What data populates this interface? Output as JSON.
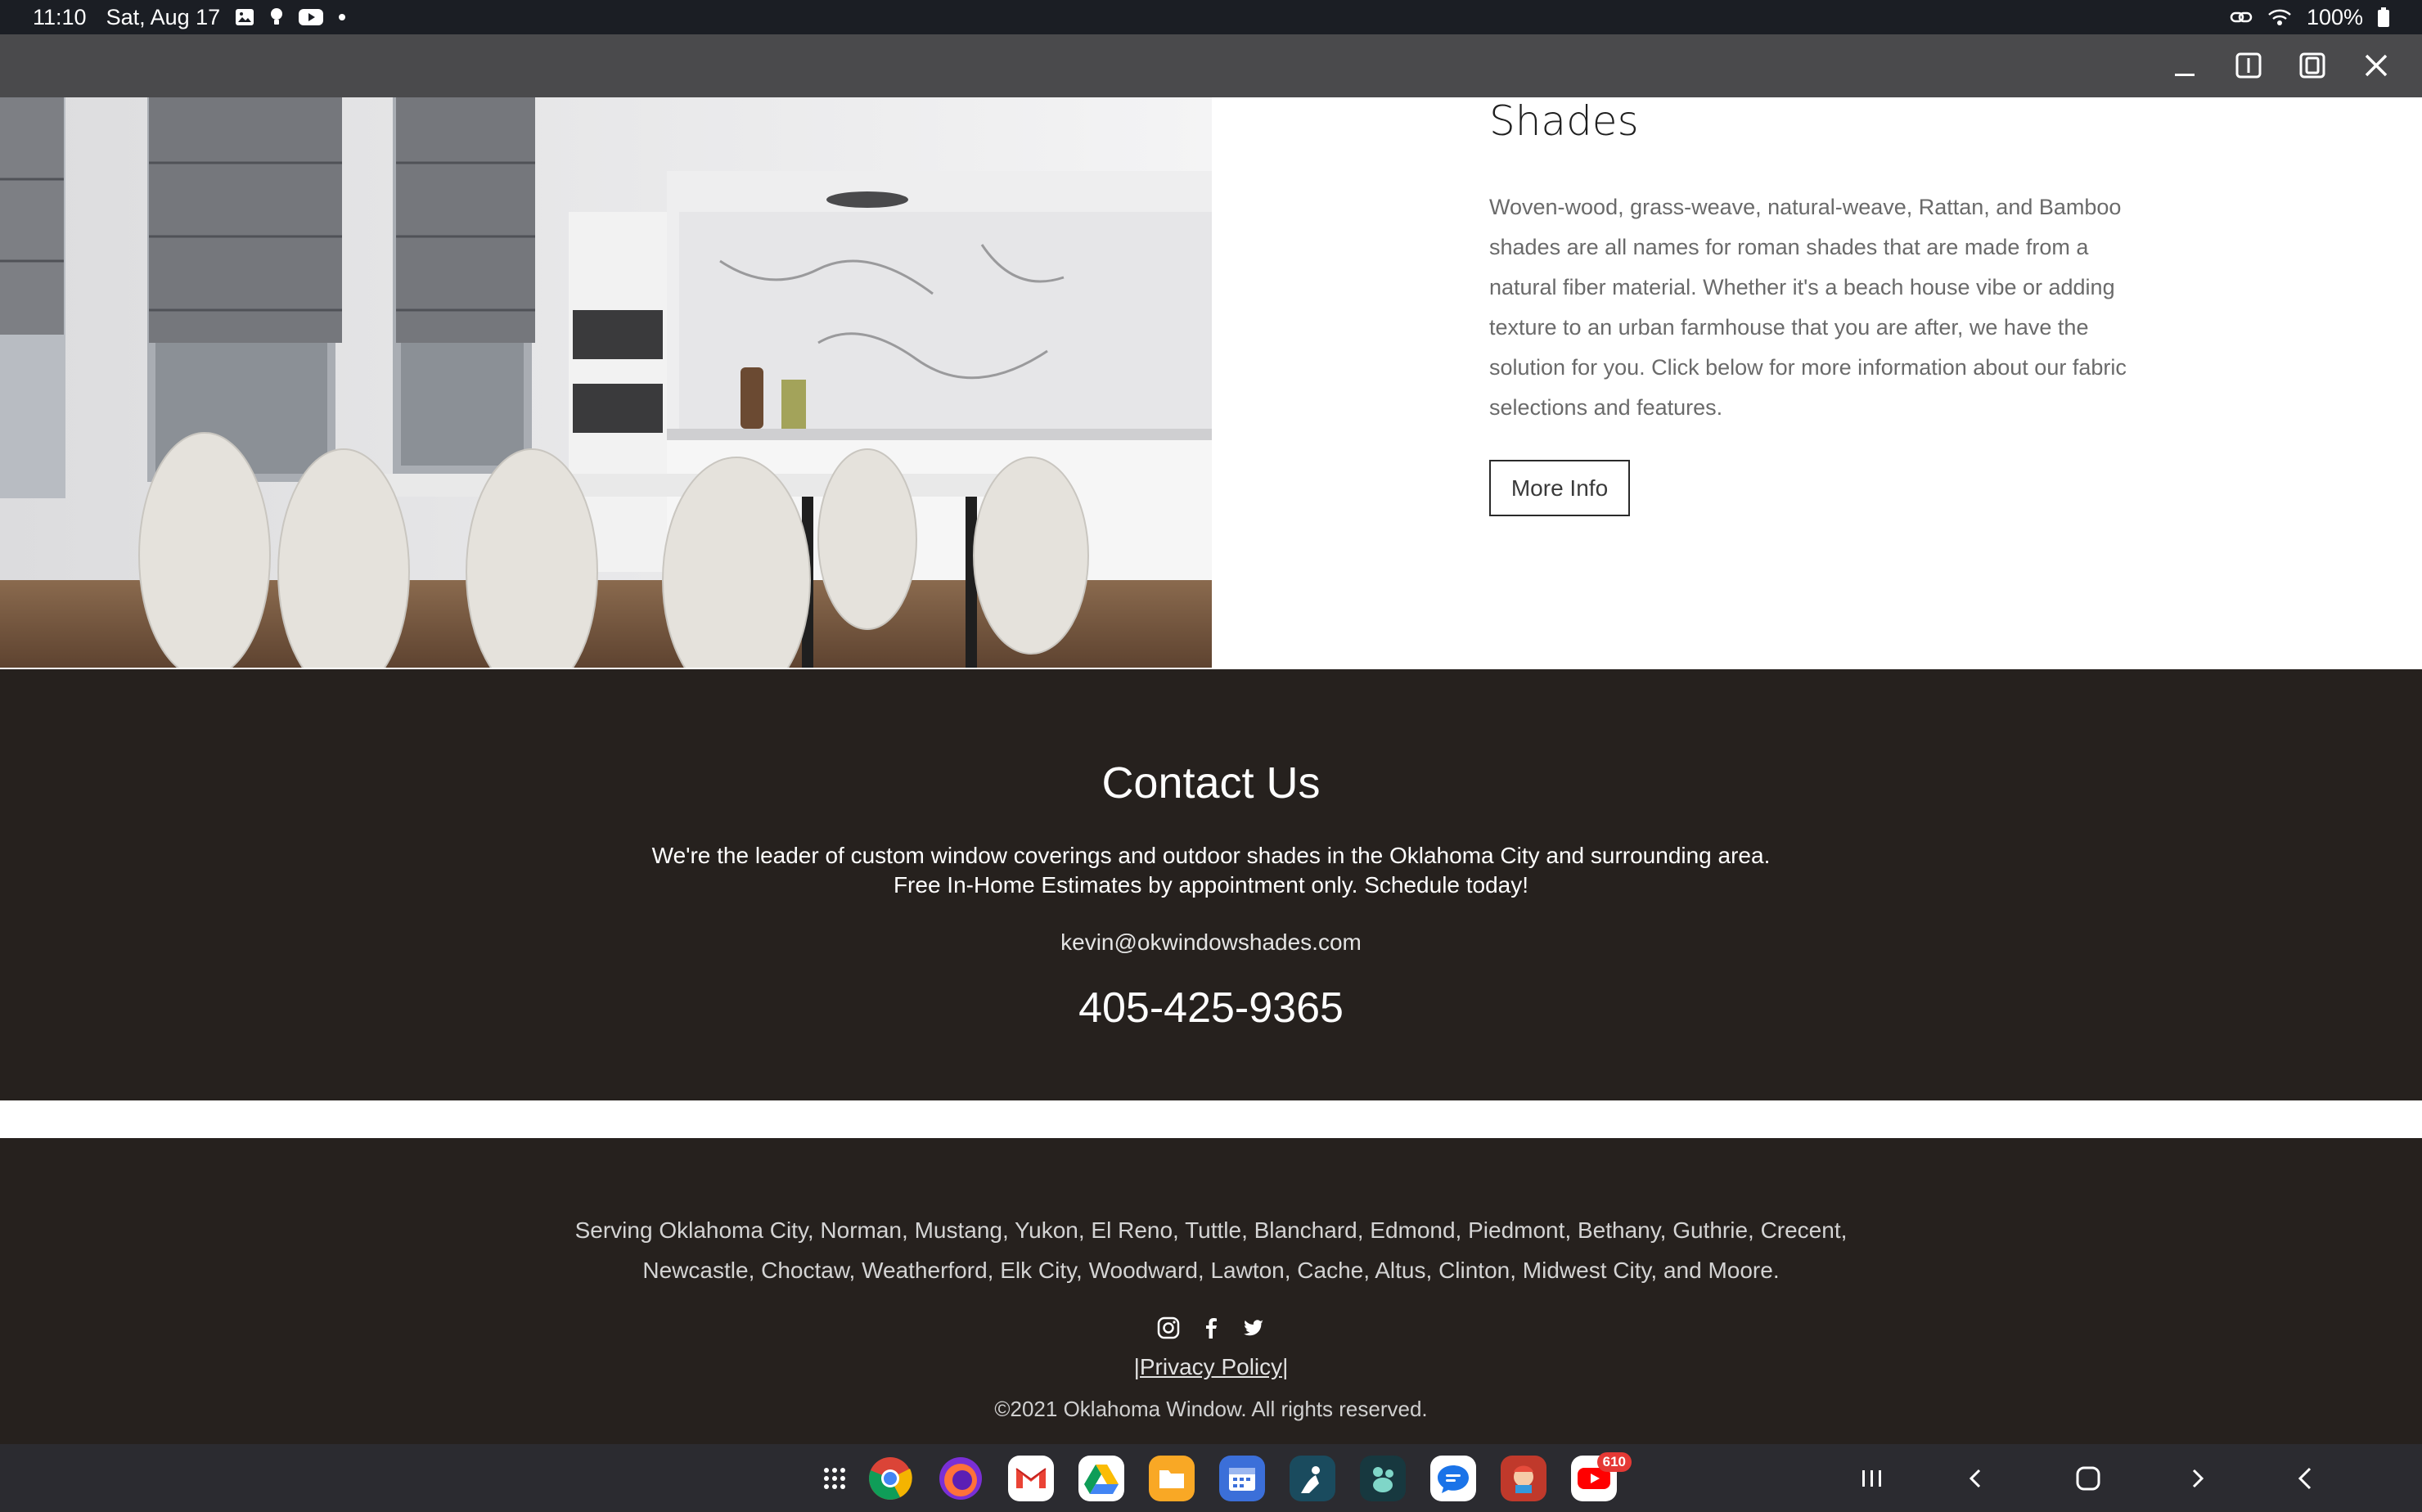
{
  "status_bar": {
    "time": "11:10",
    "date": "Sat, Aug 17",
    "notification_icons": [
      "gallery-icon",
      "tips-icon",
      "youtube-icon",
      "dot-icon"
    ],
    "battery": "100%",
    "system_icons": [
      "link-icon",
      "wifi-icon",
      "battery-icon"
    ]
  },
  "window_controls": [
    "minimize-icon",
    "split-view-icon",
    "popup-view-icon",
    "close-icon"
  ],
  "hero": {
    "title": "Shades",
    "description": "Woven-wood, grass-weave, natural-weave, Rattan, and Bamboo shades are all names for roman shades that are made from a natural fiber material. Whether it's a beach house vibe or adding texture to an urban farmhouse that you are after, we have the solution for you. Click below for more information about our fabric selections and features.",
    "button_label": "More Info"
  },
  "contact": {
    "title": "Contact Us",
    "line1": "We're the leader of custom window coverings and outdoor shades in the Oklahoma City and surrounding area.",
    "line2": "Free In-Home Estimates by appointment only. Schedule today!",
    "email": "kevin@okwindowshades.com",
    "phone": "405-425-9365"
  },
  "footer": {
    "serving_line1": "Serving Oklahoma City, Norman, Mustang, Yukon, El Reno, Tuttle, Blanchard, Edmond, Piedmont, Bethany, Guthrie, Crecent,",
    "serving_line2": "Newcastle, Choctaw, Weatherford, Elk City, Woodward, Lawton, Cache, Altus, Clinton, Midwest City, and Moore.",
    "social": [
      "instagram-icon",
      "facebook-icon",
      "twitter-icon"
    ],
    "privacy": "|Privacy Policy|",
    "copyright": "©2021 Oklahoma Window. All rights reserved."
  },
  "taskbar": {
    "apps": [
      "apps-grid",
      "chrome",
      "firefox",
      "gmail",
      "google-drive",
      "my-files",
      "calendar",
      "kindle",
      "bluesky-alt",
      "messages",
      "game",
      "youtube"
    ],
    "youtube_badge": "610",
    "nav": [
      "recents-icon",
      "back-icon",
      "home-icon",
      "forward-icon",
      "collapse-icon"
    ]
  },
  "colors": {
    "dark_section": "#26211e",
    "caption_bar": "#4a4a4c",
    "status_bar": "#1b1e24"
  }
}
